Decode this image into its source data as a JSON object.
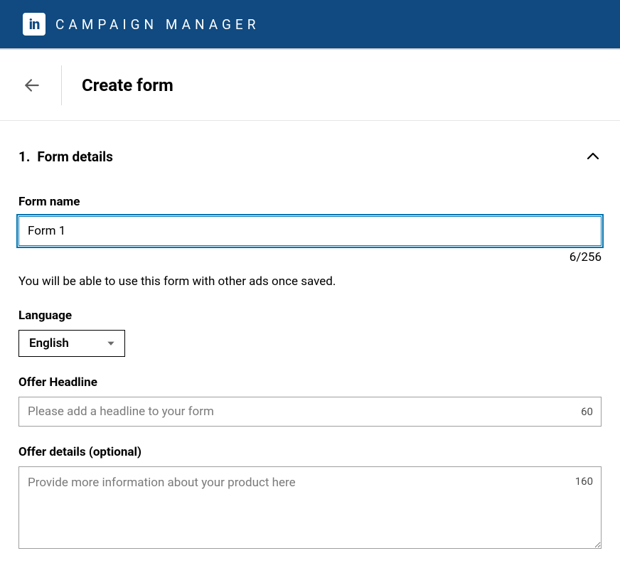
{
  "header": {
    "logo_text": "in",
    "app_title": "CAMPAIGN MANAGER"
  },
  "subheader": {
    "page_title": "Create form"
  },
  "section": {
    "number": "1.",
    "title": "Form details"
  },
  "form_name": {
    "label": "Form name",
    "value": "Form 1",
    "counter": "6/256",
    "helper": "You will be able to use this form with other ads once saved."
  },
  "language": {
    "label": "Language",
    "value": "English"
  },
  "offer_headline": {
    "label": "Offer Headline",
    "placeholder": "Please add a headline to your form",
    "max": "60"
  },
  "offer_details": {
    "label": "Offer details (optional)",
    "placeholder": "Provide more information about your product here",
    "max": "160"
  }
}
